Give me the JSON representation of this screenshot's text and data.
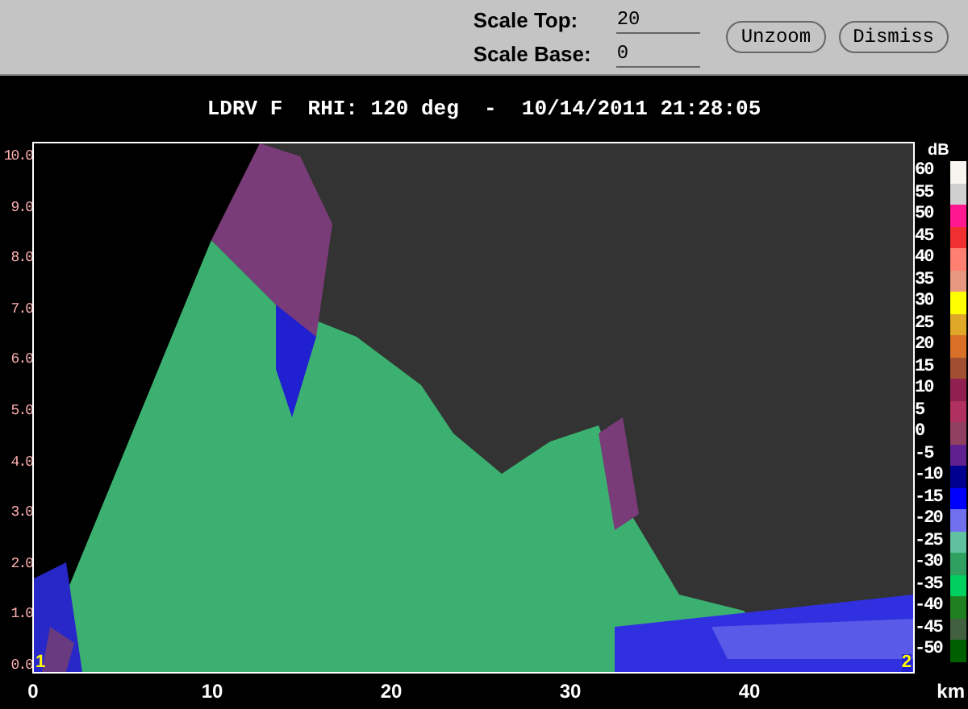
{
  "controls": {
    "fields": [
      {
        "label": "Scale Top:",
        "value": "20"
      },
      {
        "label": "Scale Base:",
        "value": "0"
      }
    ],
    "buttons": [
      "Unzoom",
      "Dismiss"
    ]
  },
  "plot": {
    "title": "LDRV F  RHI: 120 deg  -  10/14/2011 21:28:05",
    "y_ticks": [
      "10.0",
      "9.0",
      "8.0",
      "7.0",
      "6.0",
      "5.0",
      "4.0",
      "3.0",
      "2.0",
      "1.0",
      "0.0"
    ],
    "x_ticks": [
      "0",
      "10",
      "20",
      "30",
      "40"
    ],
    "x_unit": "km",
    "corner_markers": [
      "1",
      "2"
    ]
  },
  "legend": {
    "unit": "dB",
    "entries": [
      {
        "label": "60",
        "color": "#f8f4f0"
      },
      {
        "label": "55",
        "color": "#d0d0d0"
      },
      {
        "label": "50",
        "color": "#ff1890"
      },
      {
        "label": "45",
        "color": "#f03030"
      },
      {
        "label": "40",
        "color": "#ff8070"
      },
      {
        "label": "35",
        "color": "#e89880"
      },
      {
        "label": "30",
        "color": "#ffff00"
      },
      {
        "label": "25",
        "color": "#e0a828"
      },
      {
        "label": "20",
        "color": "#d87028"
      },
      {
        "label": "15",
        "color": "#a05030"
      },
      {
        "label": "10",
        "color": "#902050"
      },
      {
        "label": "5",
        "color": "#b03060"
      },
      {
        "label": "0",
        "color": "#904060"
      },
      {
        "label": "-5",
        "color": "#602090"
      },
      {
        "label": "-10",
        "color": "#000090"
      },
      {
        "label": "-15",
        "color": "#0000ff"
      },
      {
        "label": "-20",
        "color": "#7070ee"
      },
      {
        "label": "-25",
        "color": "#60c0a0"
      },
      {
        "label": "-30",
        "color": "#30a060"
      },
      {
        "label": "-35",
        "color": "#00d060"
      },
      {
        "label": "-40",
        "color": "#208020"
      },
      {
        "label": "-45",
        "color": "#406040"
      },
      {
        "label": "-50",
        "color": "#006000"
      }
    ]
  }
}
